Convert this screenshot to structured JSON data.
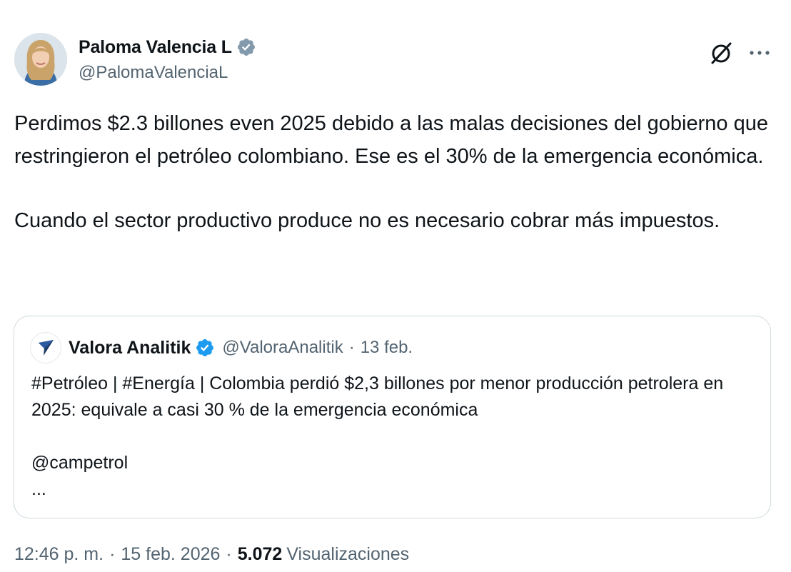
{
  "author": {
    "display_name": "Paloma Valencia L",
    "handle": "@PalomaValenciaL",
    "verified_color": "#829aab",
    "avatar_icon": "woman-portrait-avatar"
  },
  "actions": {
    "grok_icon": "grok-icon",
    "more_icon": "more-dots-icon"
  },
  "tweet": {
    "paragraph_1": "Perdimos $2.3 billones even 2025 debido a las malas decisiones del gobierno que restringieron el petróleo colombiano. Ese es el 30% de la emergencia económica.",
    "paragraph_2": "Cuando el sector productivo produce no es necesario cobrar más impuestos."
  },
  "quoted": {
    "display_name": "Valora Analitik",
    "handle": "@ValoraAnalitik",
    "separator": "·",
    "date": "13 feb.",
    "verified_color": "#1d9bf0",
    "text_1": "#Petróleo | #Energía | Colombia perdió $2,3 billones por menor producción petrolera en 2025: equivale a casi 30 % de la emergencia económica",
    "text_2": "@campetrol",
    "text_3": "..."
  },
  "meta": {
    "time": "12:46 p. m.",
    "separator": "·",
    "date": "15 feb. 2026",
    "views_count": "5.072",
    "views_label": "Visualizaciones"
  }
}
